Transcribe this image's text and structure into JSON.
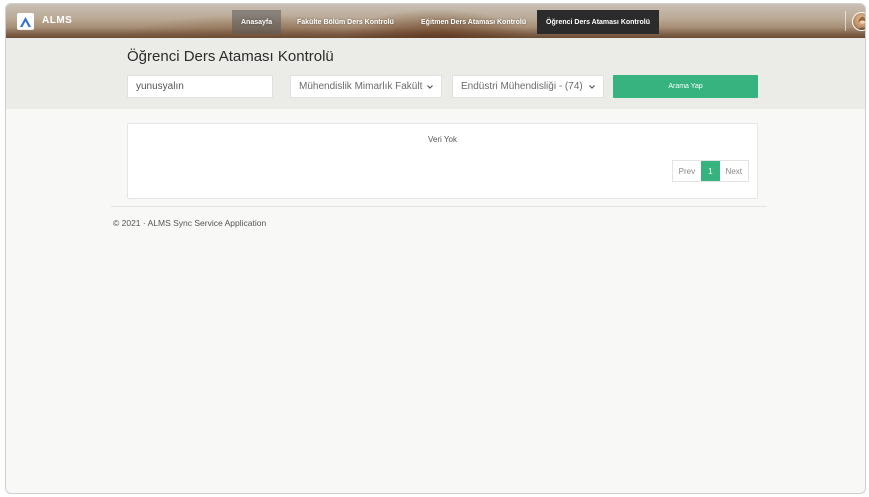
{
  "app": {
    "logo_text": "ALMS",
    "brand_color": "#2f6fd6"
  },
  "nav": {
    "items": [
      {
        "label": "Anasayfa"
      },
      {
        "label": "Fakülte Bölüm Ders Kontrolü"
      },
      {
        "label": "Eğitmen Ders Ataması Kontrolü"
      },
      {
        "label": "Öğrenci Ders Ataması Kontrolü"
      }
    ]
  },
  "page": {
    "title": "Öğrenci Ders Ataması Kontrolü"
  },
  "filters": {
    "username_value": "yunusyalın",
    "faculty_selected": "Mühendislik Mimarlık Fakültesi",
    "department_selected": "Endüstri Mühendisliği - (74)",
    "search_label": "Arama Yap",
    "accent_color": "#36b37e"
  },
  "results": {
    "empty_text": "Veri Yok"
  },
  "pagination": {
    "prev_label": "Prev",
    "current_page": "1",
    "next_label": "Next"
  },
  "footer": {
    "text": "© 2021 · ALMS Sync Service Application"
  },
  "icons": {
    "logo": "alms-logo-icon",
    "avatar": "user-avatar",
    "select_chevron": "chevron-down-icon"
  }
}
